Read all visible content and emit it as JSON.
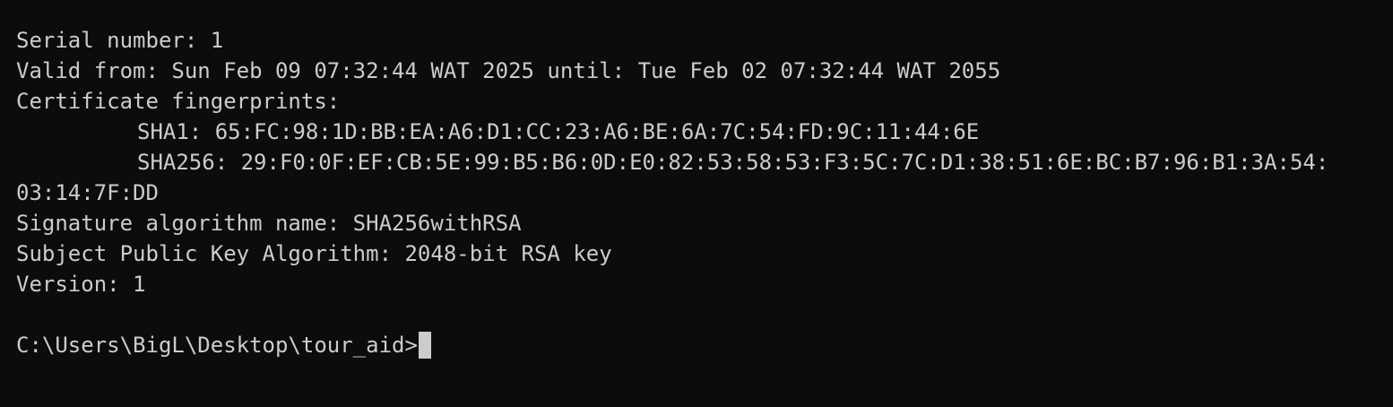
{
  "terminal": {
    "colors": {
      "background": "#0c0c0c",
      "foreground": "#cccccc",
      "cursor": "#cccccc"
    },
    "lines": {
      "serial": "Serial number: 1",
      "validity": "Valid from: Sun Feb 09 07:32:44 WAT 2025 until: Tue Feb 02 07:32:44 WAT 2055",
      "fingerprints_header": "Certificate fingerprints:",
      "sha1": "SHA1: 65:FC:98:1D:BB:EA:A6:D1:CC:23:A6:BE:6A:7C:54:FD:9C:11:44:6E",
      "sha256_part1": "SHA256: 29:F0:0F:EF:CB:5E:99:B5:B6:0D:E0:82:53:58:53:F3:5C:7C:D1:38:51:6E:BC:B7:96:B1:3A:54:",
      "sha256_part2": "03:14:7F:DD",
      "signature_algorithm": "Signature algorithm name: SHA256withRSA",
      "public_key_algorithm": "Subject Public Key Algorithm: 2048-bit RSA key",
      "version": "Version: 1"
    },
    "prompt": "C:\\Users\\BigL\\Desktop\\tour_aid>"
  }
}
